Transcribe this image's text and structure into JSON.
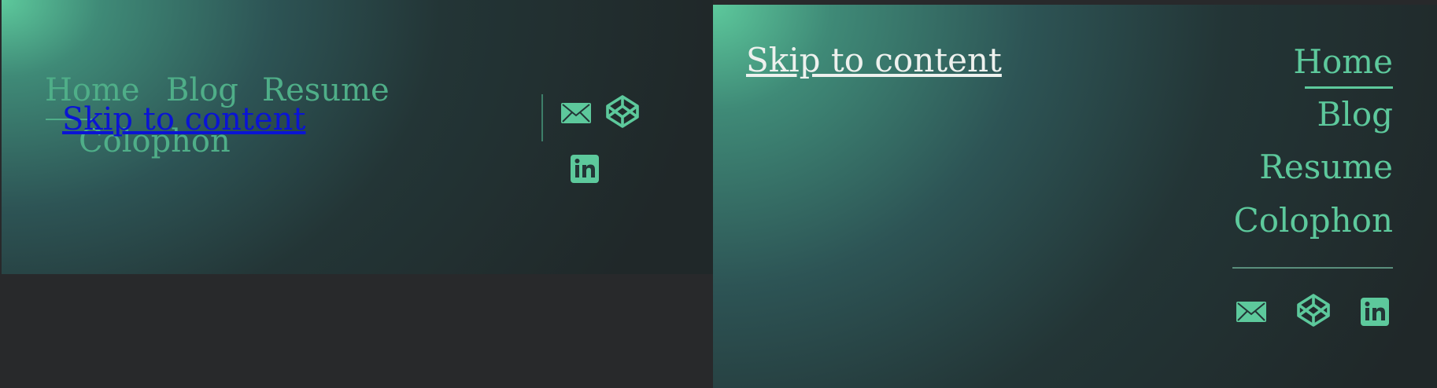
{
  "skip_link": "Skip to content",
  "nav": {
    "home": "Home",
    "blog": "Blog",
    "resume": "Resume",
    "colophon": "Colophon"
  },
  "icons": [
    "mail-icon",
    "codepen-icon",
    "linkedin-icon"
  ],
  "colors": {
    "accent": "#5dc99c",
    "page_background": "#28292b",
    "gradient_dark": "#202829",
    "skip_link_left": "#0a14d4",
    "skip_link_right": "#eef1ee"
  }
}
